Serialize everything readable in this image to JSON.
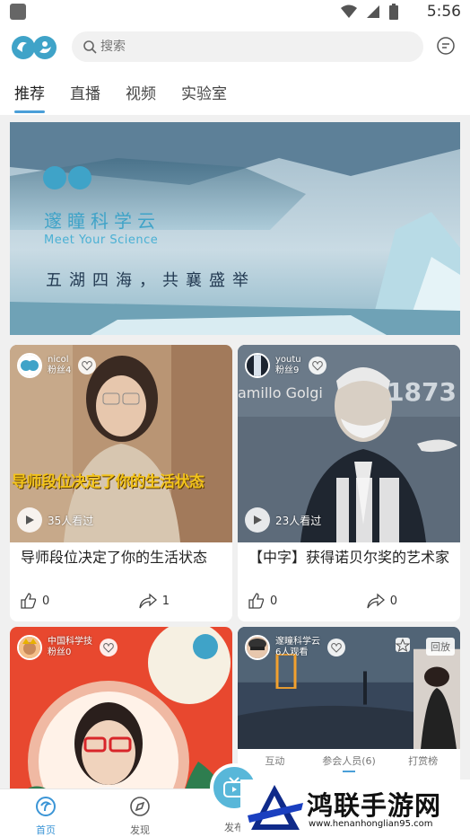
{
  "status": {
    "time": "5:56"
  },
  "search": {
    "placeholder": "搜索"
  },
  "tabs": [
    {
      "label": "推荐"
    },
    {
      "label": "直播"
    },
    {
      "label": "视频"
    },
    {
      "label": "实验室"
    }
  ],
  "banner": {
    "brand": "邃瞳科学云",
    "subtitle": "Meet Your Science",
    "slogan": "五湖四海，共襄盛举"
  },
  "cards": [
    {
      "author": "nicol",
      "fans": "粉丝4",
      "views": "35人看过",
      "overlay": "导师段位决定了你的生活状态",
      "title": "导师段位决定了你的生活状态",
      "likes": "0",
      "shares": "1"
    },
    {
      "author": "youtu",
      "fans": "粉丝9",
      "views": "23人看过",
      "overlay_left": "amillo Golgi",
      "overlay_right": "1873",
      "title": "【中字】获得诺贝尔奖的艺术家",
      "likes": "0",
      "shares": "0"
    },
    {
      "author": "中国科学技",
      "fans": "粉丝0"
    },
    {
      "author": "邃瞳科学云",
      "fans": "6人观看",
      "badge": "回放",
      "live_tabs": [
        "互动",
        "参会人员(6)",
        "打赏榜"
      ]
    }
  ],
  "bottomnav": {
    "home": "首页",
    "discover": "发现",
    "publish": "发布"
  },
  "watermark": {
    "title": "鸿联手游网",
    "url": "www.henanhonglian95.com"
  },
  "colors": {
    "accent": "#4a9fd8",
    "publish": "#58b7d9",
    "overlay_text": "#f2c31a"
  }
}
